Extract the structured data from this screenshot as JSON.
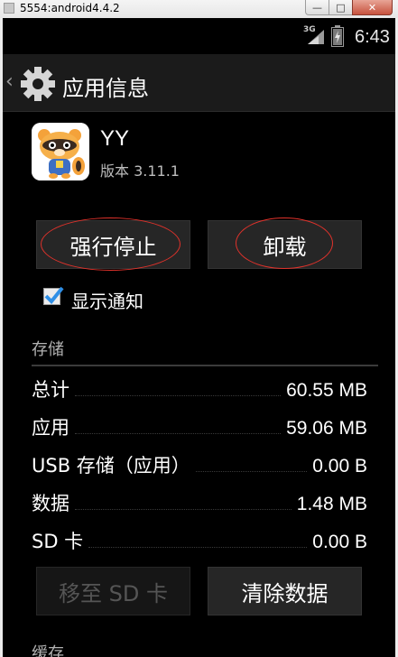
{
  "window": {
    "title": "5554:android4.4.2",
    "min_glyph": "—",
    "max_glyph": "□",
    "close_glyph": "✕"
  },
  "status_bar": {
    "network": "3G",
    "time": "6:43"
  },
  "action_bar": {
    "title": "应用信息",
    "icon": "gear-icon"
  },
  "app": {
    "name": "YY",
    "version": "版本 3.11.1",
    "icon": "raccoon-app-icon"
  },
  "buttons": {
    "force_stop": "强行停止",
    "uninstall": "卸载",
    "move_to_sd": "移至 SD 卡",
    "clear_data": "清除数据"
  },
  "notifications": {
    "label": "显示通知",
    "checked": true
  },
  "storage": {
    "header": "存储",
    "rows": [
      {
        "label": "总计",
        "value": "60.55 MB"
      },
      {
        "label": "应用",
        "value": "59.06 MB"
      },
      {
        "label": "USB 存储（应用）",
        "value": "0.00 B"
      },
      {
        "label": "数据",
        "value": "1.48 MB"
      },
      {
        "label": "SD 卡",
        "value": "0.00 B"
      }
    ]
  },
  "cache": {
    "header": "缓存"
  },
  "colors": {
    "screen_bg": "#000000",
    "actionbar_bg": "#1b1b1b",
    "button_bg": "#262626",
    "checkbox_accent": "#2f8fe6",
    "annotation": "#e0322b"
  }
}
